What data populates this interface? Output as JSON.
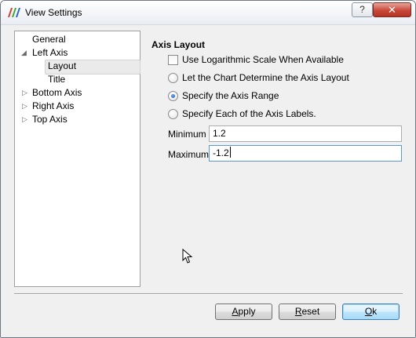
{
  "window": {
    "title": "View Settings",
    "help_glyph": "?",
    "close_glyph": "✕"
  },
  "tree": {
    "items": [
      {
        "label": "General",
        "level": 0,
        "expander": "none",
        "selected": false
      },
      {
        "label": "Left Axis",
        "level": 0,
        "expander": "expanded",
        "selected": false
      },
      {
        "label": "Layout",
        "level": 1,
        "expander": "none",
        "selected": true
      },
      {
        "label": "Title",
        "level": 1,
        "expander": "none",
        "selected": false
      },
      {
        "label": "Bottom Axis",
        "level": 0,
        "expander": "collapsed",
        "selected": false
      },
      {
        "label": "Right Axis",
        "level": 0,
        "expander": "collapsed",
        "selected": false
      },
      {
        "label": "Top Axis",
        "level": 0,
        "expander": "collapsed",
        "selected": false
      }
    ]
  },
  "axis_layout": {
    "title": "Axis Layout",
    "log_scale_label": "Use Logarithmic Scale When Available",
    "log_scale_checked": false,
    "options": [
      {
        "label": "Let the Chart Determine the Axis Layout",
        "checked": false
      },
      {
        "label": "Specify the Axis Range",
        "checked": true
      },
      {
        "label": "Specify Each of the Axis Labels.",
        "checked": false
      }
    ],
    "minimum_label": "Minimum",
    "minimum_value": "1.2",
    "maximum_label": "Maximum",
    "maximum_value": "-1.2"
  },
  "buttons": {
    "apply_rest": "pply",
    "apply_mnemonic": "A",
    "reset_rest": "eset",
    "reset_mnemonic": "R",
    "ok_rest": "k",
    "ok_mnemonic": "O"
  },
  "colors": {
    "accent": "#1d5fb0",
    "close_button": "#c9483a"
  }
}
